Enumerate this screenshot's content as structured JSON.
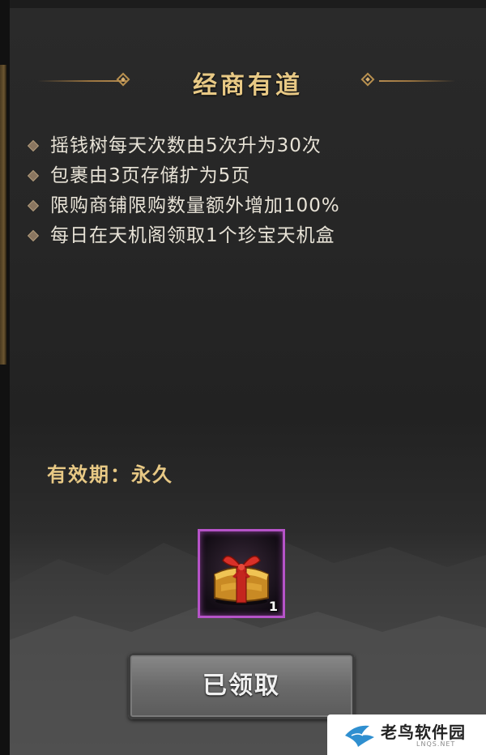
{
  "title": "经商有道",
  "perks": [
    "摇钱树每天次数由5次升为30次",
    "包裹由3页存储扩为5页",
    "限购商铺限购数量额外增加100%",
    "每日在天机阁领取1个珍宝天机盒"
  ],
  "validity": "有效期：永久",
  "reward": {
    "icon": "treasure-chest-icon",
    "count": "1",
    "rarity_color": "#b653c8"
  },
  "claim_button_label": "已领取",
  "watermark": {
    "name": "老鸟软件园",
    "sub": "LNQS.NET"
  },
  "colors": {
    "title": "#e8c985",
    "text": "#e7e2d6",
    "button": "#6a6a6a"
  }
}
